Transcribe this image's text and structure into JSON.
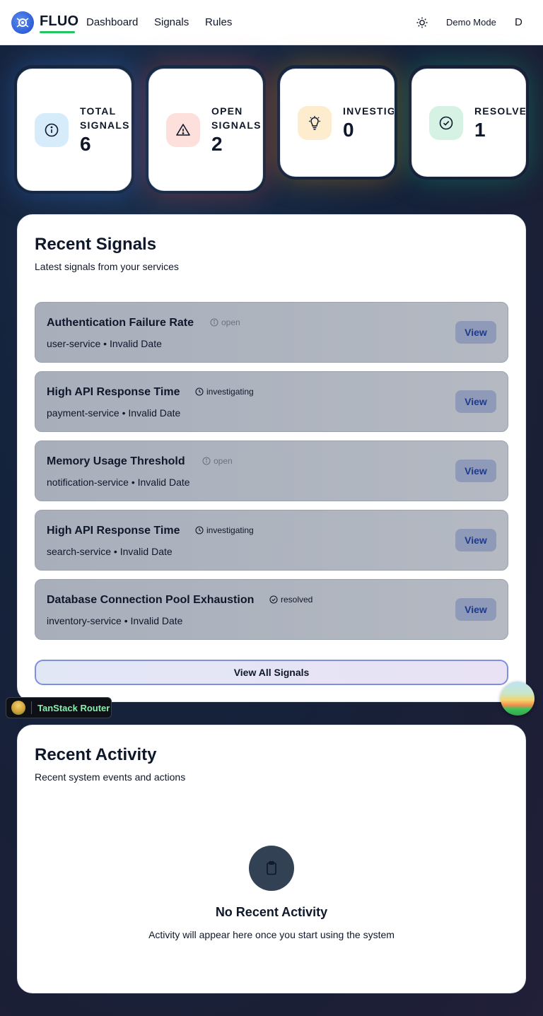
{
  "header": {
    "brand": "FLUO",
    "nav": [
      "Dashboard",
      "Signals",
      "Rules"
    ],
    "demo_mode": "Demo Mode",
    "user_initial": "D",
    "icons": {
      "logo": "fluo-logo-icon",
      "theme": "sun-icon"
    }
  },
  "stats": [
    {
      "label": "TOTAL SIGNALS",
      "value": "6",
      "icon": "info-icon",
      "icon_bg": "#d7ecfb",
      "glow": "#3b82f6"
    },
    {
      "label": "OPEN SIGNALS",
      "value": "2",
      "icon": "alert-triangle-icon",
      "icon_bg": "#fde0dc",
      "glow": "#ef4444"
    },
    {
      "label": "INVESTIGATING",
      "value": "0",
      "icon": "lightbulb-icon",
      "icon_bg": "#fdeccd",
      "glow": "#f59e0b"
    },
    {
      "label": "RESOLVED",
      "value": "1",
      "icon": "check-circle-icon",
      "icon_bg": "#d6f2e4",
      "glow": "#10b981"
    }
  ],
  "recent_signals": {
    "title": "Recent Signals",
    "subtitle": "Latest signals from your services",
    "items": [
      {
        "title": "Authentication Failure Rate",
        "status": "open",
        "service": "user-service",
        "date": "Invalid Date",
        "action": "View"
      },
      {
        "title": "High API Response Time",
        "status": "investigating",
        "service": "payment-service",
        "date": "Invalid Date",
        "action": "View"
      },
      {
        "title": "Memory Usage Threshold",
        "status": "open",
        "service": "notification-service",
        "date": "Invalid Date",
        "action": "View"
      },
      {
        "title": "High API Response Time",
        "status": "investigating",
        "service": "search-service",
        "date": "Invalid Date",
        "action": "View"
      },
      {
        "title": "Database Connection Pool Exhaustion",
        "status": "resolved",
        "service": "inventory-service",
        "date": "Invalid Date",
        "action": "View"
      }
    ],
    "view_all": "View All Signals"
  },
  "devtools": {
    "label": "TanStack Router"
  },
  "recent_activity": {
    "title": "Recent Activity",
    "subtitle": "Recent system events and actions",
    "empty_title": "No Recent Activity",
    "empty_text": "Activity will appear here once you start using the system",
    "empty_icon": "clipboard-icon"
  }
}
